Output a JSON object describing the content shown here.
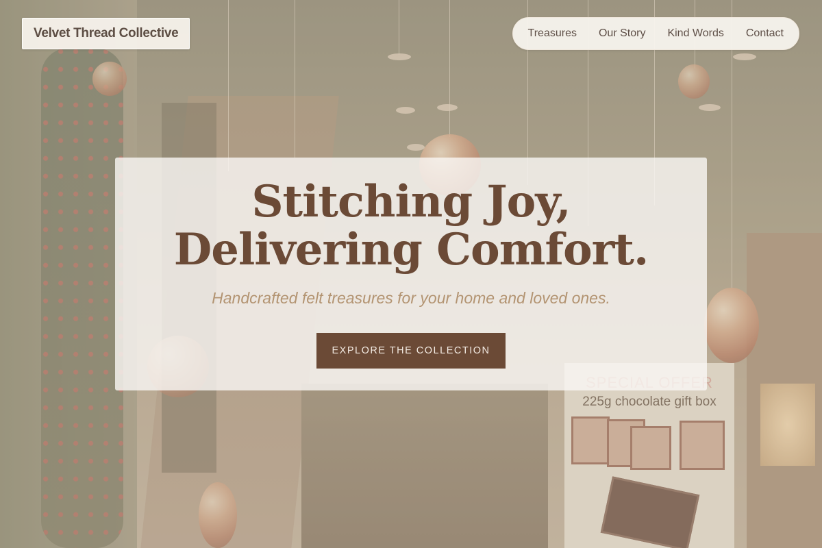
{
  "brand": {
    "name": "Velvet Thread Collective"
  },
  "nav": {
    "items": [
      "Treasures",
      "Our Story",
      "Kind Words",
      "Contact"
    ]
  },
  "hero": {
    "title_line1": "Stitching Joy,",
    "title_line2": "Delivering Comfort.",
    "subtitle": "Handcrafted felt treasures for your home and loved ones.",
    "cta_label": "EXPLORE THE COLLECTION"
  },
  "background": {
    "sign_offer": "SPECIAL OFFER",
    "sign_product": "225g chocolate gift box"
  },
  "colors": {
    "primary_brown": "#6b4a36",
    "accent_tan": "#b39472",
    "card_background": "#faf8f5"
  }
}
